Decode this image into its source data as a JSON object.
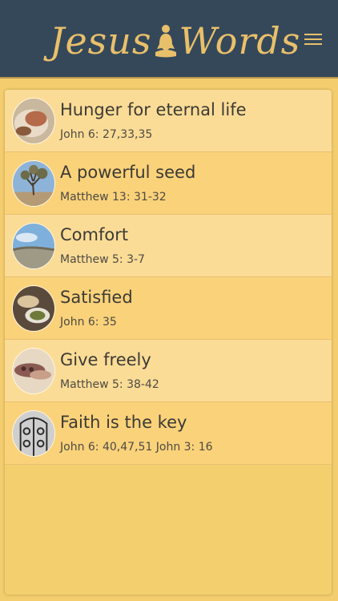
{
  "header": {
    "logo_word_1": "Jesus",
    "logo_word_2": "Words",
    "logo_icon": "meditating-figure-icon",
    "menu_icon": "hamburger-menu-icon",
    "accent_color": "#e9c06a",
    "bar_color": "#35485a"
  },
  "items": [
    {
      "title": "Hunger for eternal life",
      "reference": "John 6: 27,33,35",
      "thumbnail": "bread-image"
    },
    {
      "title": "A powerful seed",
      "reference": "Matthew 13: 31-32",
      "thumbnail": "tree-image"
    },
    {
      "title": "Comfort",
      "reference": "Matthew 5: 3-7",
      "thumbnail": "landscape-image"
    },
    {
      "title": "Satisfied",
      "reference": "John 6: 35",
      "thumbnail": "meal-image"
    },
    {
      "title": "Give freely",
      "reference": "Matthew 5: 38-42",
      "thumbnail": "hands-image"
    },
    {
      "title": "Faith is the key",
      "reference": "John 6: 40,47,51 John 3: 16",
      "thumbnail": "gate-image"
    }
  ]
}
